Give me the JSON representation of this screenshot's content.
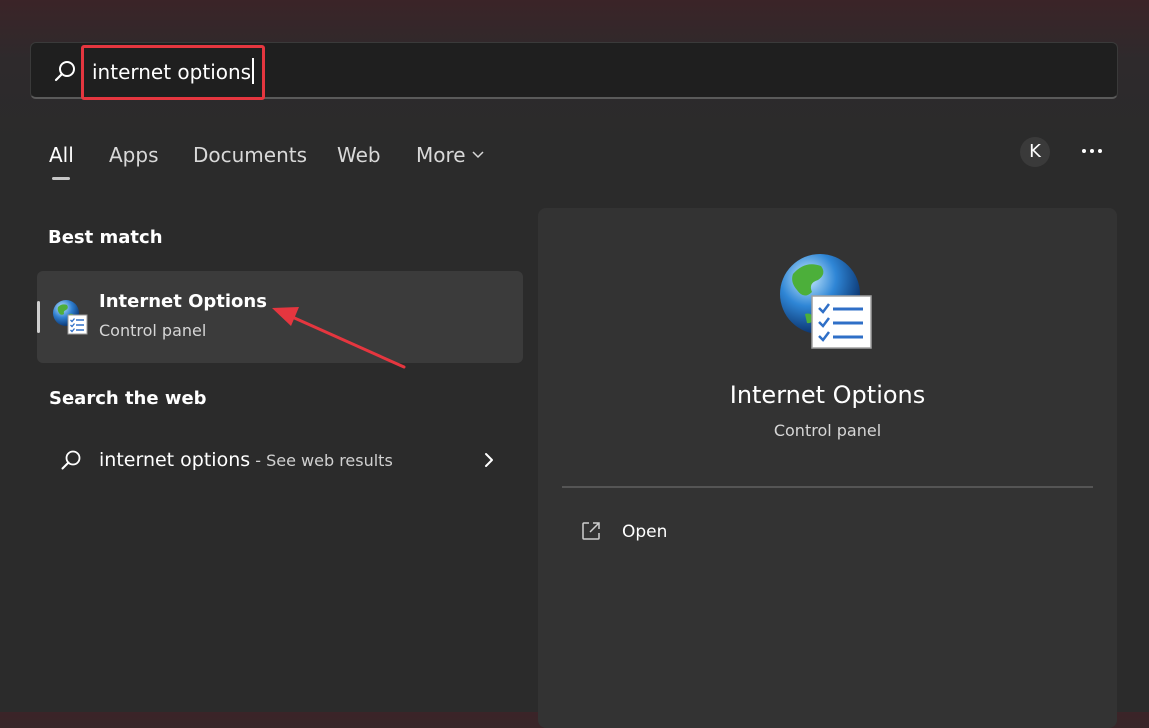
{
  "search": {
    "query": "internet options"
  },
  "tabs": [
    {
      "label": "All",
      "active": true
    },
    {
      "label": "Apps"
    },
    {
      "label": "Documents"
    },
    {
      "label": "Web"
    },
    {
      "label": "More"
    }
  ],
  "header": {
    "avatar_initial": "K"
  },
  "best_match": {
    "heading": "Best match",
    "title": "Internet Options",
    "subtitle": "Control panel"
  },
  "web": {
    "heading": "Search the web",
    "query": "internet options",
    "suffix": " - See web results"
  },
  "preview": {
    "title": "Internet Options",
    "subtitle": "Control panel",
    "action_open": "Open"
  },
  "icons": {
    "search": "search-icon",
    "app": "internet-options-icon",
    "chevron_down": "chevron-down-icon",
    "chevron_right": "chevron-right-icon",
    "more": "more-icon",
    "open": "open-external-icon"
  },
  "colors": {
    "annotation": "#e5363f",
    "background": "#2b2b2b",
    "selected_item": "#3b3b3b",
    "preview_pane": "#333333"
  }
}
